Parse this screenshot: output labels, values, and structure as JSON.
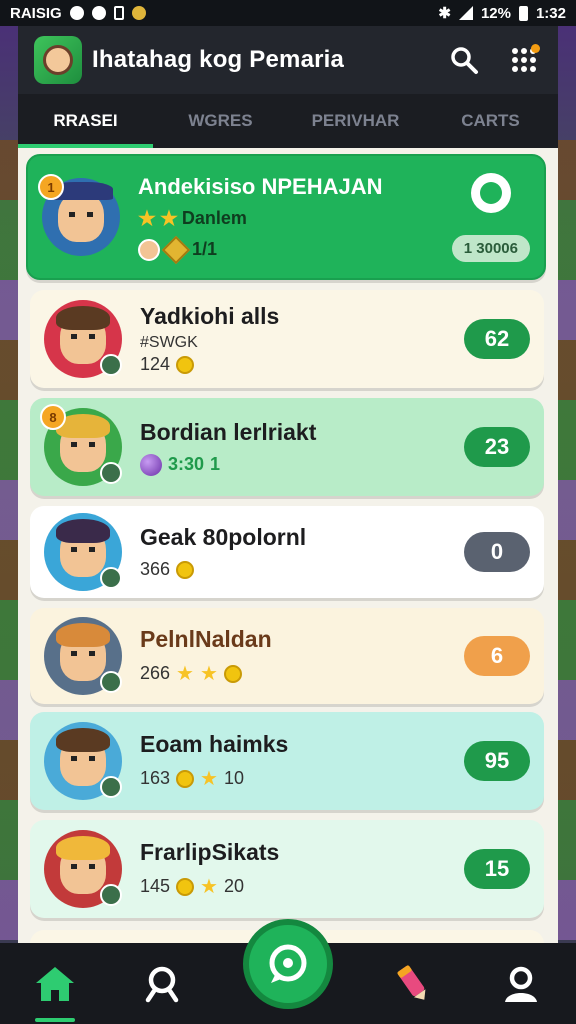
{
  "status_bar": {
    "left_text": "RAISIG",
    "battery": "12%",
    "time": "1:32"
  },
  "app_bar": {
    "title": "Ihatahag kog Pemaria"
  },
  "tabs": [
    {
      "label": "RRASEI",
      "active": true
    },
    {
      "label": "WGRES",
      "active": false
    },
    {
      "label": "PERIVHAR",
      "active": false
    },
    {
      "label": "CARTS",
      "active": false
    }
  ],
  "hero": {
    "rank": "1",
    "name": "Andekisiso NPEHAJAN",
    "tag": "Danlem",
    "stat": "1/1",
    "pill": "1 30006"
  },
  "players": [
    {
      "name": "Yadkiohi alls",
      "sub": "#SWGK",
      "stat": "124",
      "score": "62",
      "score_color": "#1f9a4b",
      "card_bg": "#fbf6e6",
      "avatar_bg": "#d6354a",
      "hair": "#5a3a22"
    },
    {
      "name": "Bordian lerlriakt",
      "rank": "8",
      "stat": "3:30",
      "stat2": "1",
      "score": "23",
      "score_color": "#1f9a4b",
      "card_bg": "#b8ecc8",
      "avatar_bg": "#3aa84a",
      "hair": "#e6b43a"
    },
    {
      "name": "Geak 80polornl",
      "stat": "366",
      "score": "0",
      "score_color": "#5a6270",
      "card_bg": "#ffffff",
      "avatar_bg": "#3aa6d8",
      "hair": "#3a2a4a"
    },
    {
      "name": "PelnlNaldan",
      "stat": "266",
      "score": "6",
      "score_color": "#f0a04b",
      "card_bg": "#fbf3de",
      "avatar_bg": "#58708a",
      "hair": "#d88a3a"
    },
    {
      "name": "Eoam haimks",
      "stat": "163",
      "stat2": "10",
      "score": "95",
      "score_color": "#1f9a4b",
      "card_bg": "#bff0e6",
      "avatar_bg": "#4aaad8",
      "hair": "#5a3a22"
    },
    {
      "name": "FrarlipSikats",
      "stat": "145",
      "stat2": "20",
      "score": "15",
      "score_color": "#1f9a4b",
      "card_bg": "#e2f8ec",
      "avatar_bg": "#c23a3a",
      "hair": "#f0b83a"
    }
  ],
  "bottom_nav": [
    "home-icon",
    "search-icon",
    "chat-fab-icon",
    "pencil-icon",
    "profile-icon"
  ]
}
